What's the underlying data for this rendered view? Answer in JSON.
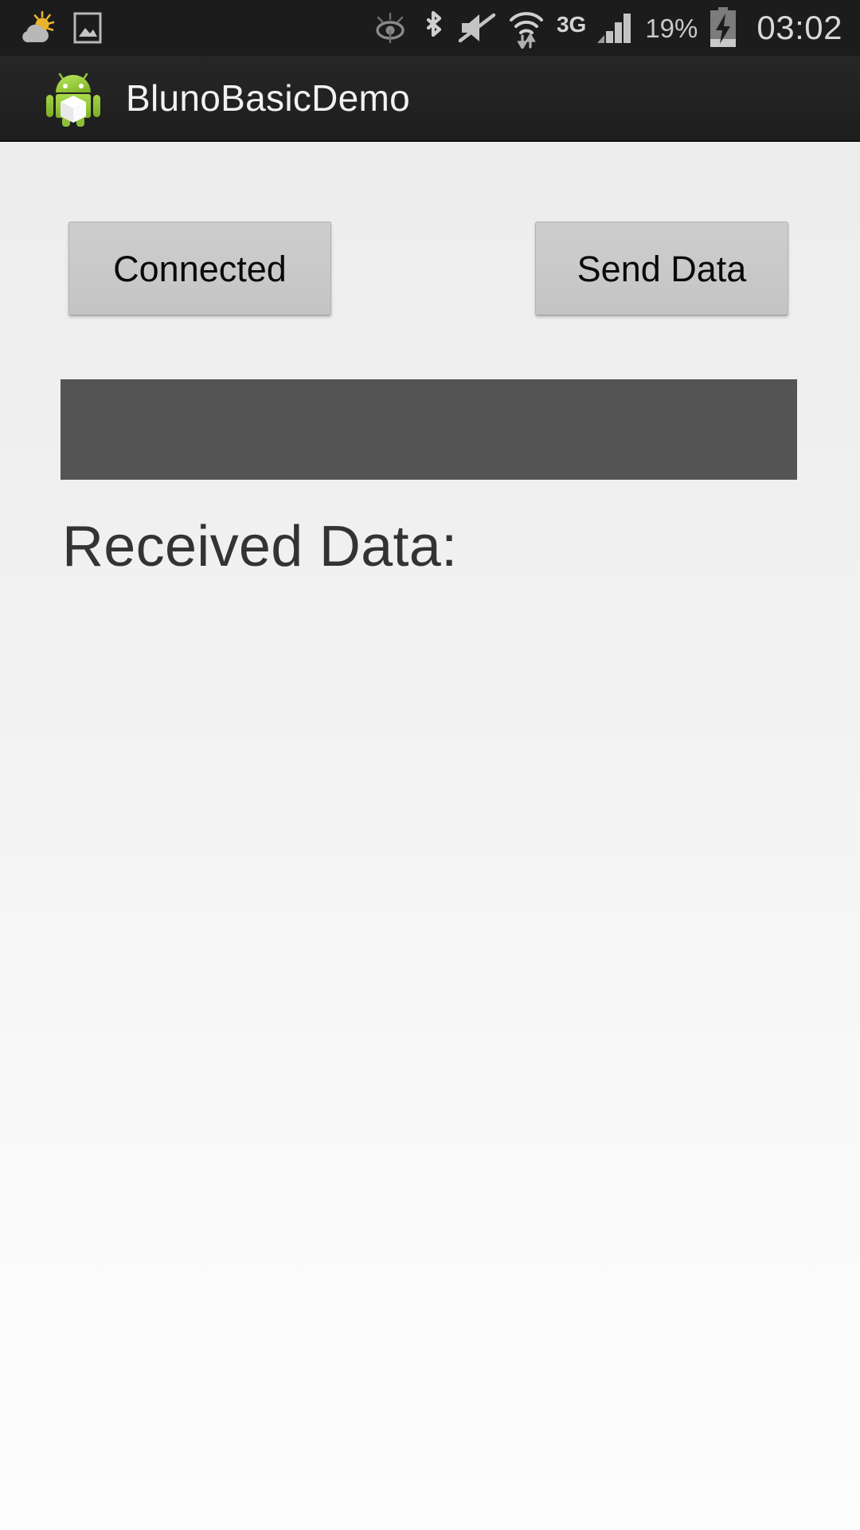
{
  "status_bar": {
    "left_icons": [
      {
        "name": "weather-partly-cloudy-icon",
        "label": "Weather"
      },
      {
        "name": "screenshot-image-icon",
        "label": "Screenshot captured"
      }
    ],
    "right_icons": [
      {
        "name": "smart-stay-eye-icon",
        "label": "Smart stay"
      },
      {
        "name": "bluetooth-icon",
        "label": "Bluetooth on"
      },
      {
        "name": "sound-mute-icon",
        "label": "Sound muted"
      },
      {
        "name": "wifi-icon",
        "label": "Wi-Fi connected"
      },
      {
        "name": "signal-bars-icon",
        "label": "Cellular signal"
      },
      {
        "name": "battery-charging-icon",
        "label": "Battery charging"
      }
    ],
    "network_type": "3G",
    "battery_percent": "19%",
    "clock": "03:02",
    "background_color": "#1c1c1c",
    "icon_color": "#c9c9c9"
  },
  "action_bar": {
    "app_icon_name": "android-robot-icon",
    "title": "BlunoBasicDemo",
    "background_color": "#222222",
    "title_color": "#f2f2f2"
  },
  "main": {
    "connection_button": {
      "label": "Connected",
      "state": "connected"
    },
    "send_button": {
      "label": "Send Data"
    },
    "serial_input": {
      "value": "",
      "placeholder": "",
      "background_color": "#545454"
    },
    "received_data": {
      "label": "Received Data:",
      "value": ""
    },
    "background_color": "#ededed"
  }
}
